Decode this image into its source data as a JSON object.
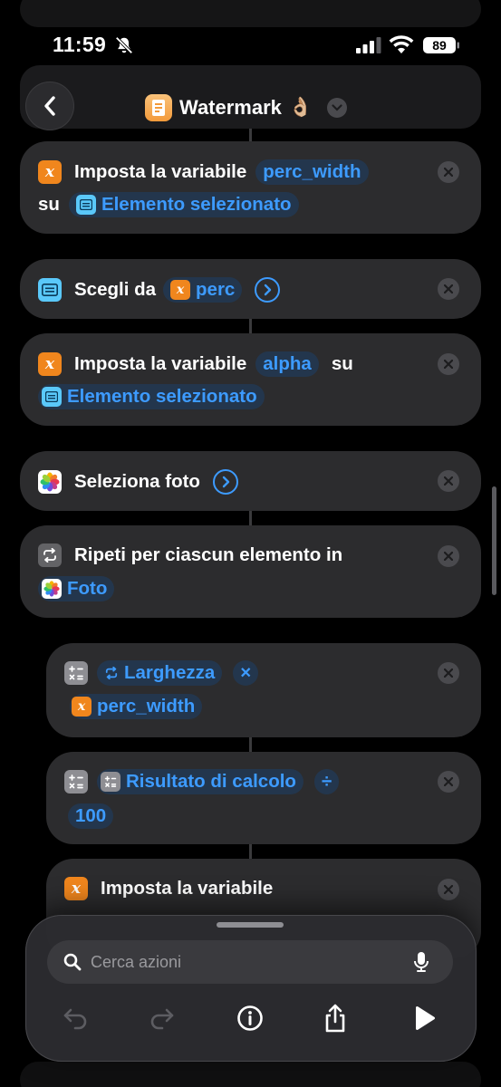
{
  "status": {
    "time": "11:59",
    "battery": "89"
  },
  "header": {
    "title": "Watermark",
    "emoji": "👌🏼"
  },
  "actions": {
    "a1": {
      "label": "Imposta la variabile",
      "var": "perc_width",
      "conj": "su",
      "value": "Elemento selezionato"
    },
    "a2": {
      "label": "Scegli da",
      "var": "perc"
    },
    "a3": {
      "label": "Imposta la variabile",
      "var": "alpha",
      "conj": "su",
      "value": "Elemento selezionato"
    },
    "a4": {
      "label": "Seleziona foto"
    },
    "a5": {
      "label": "Ripeti per ciascun elemento in",
      "value": "Foto"
    },
    "a6": {
      "operand1": "Larghezza",
      "operator": "×",
      "operand2": "perc_width"
    },
    "a7": {
      "operand1": "Risultato di calcolo",
      "operator": "÷",
      "operand2": "100"
    },
    "a8": {
      "label": "Imposta la variabile"
    }
  },
  "bottom": {
    "search_placeholder": "Cerca azioni"
  },
  "colors": {
    "accent": "#3d9bff",
    "card": "#2c2c2e",
    "variable": "#f0861d"
  }
}
